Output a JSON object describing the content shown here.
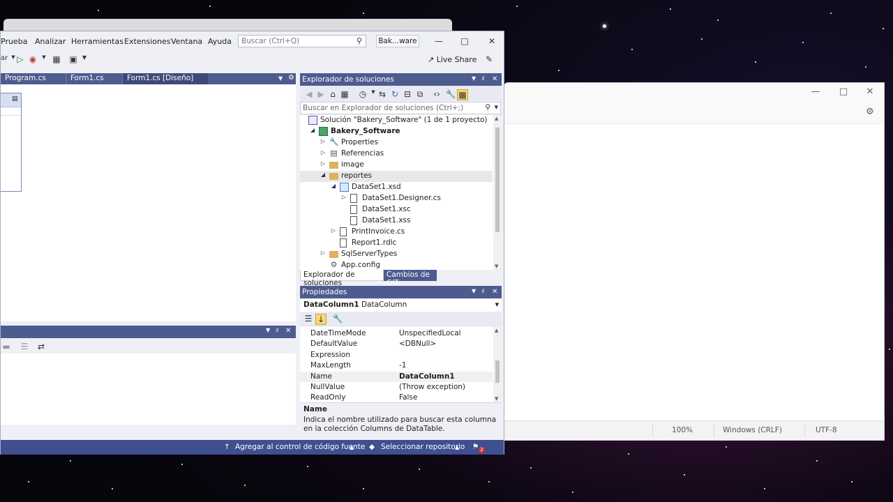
{
  "notepad": {
    "zoom": "100%",
    "line_ending": "Windows (CRLF)",
    "encoding": "UTF-8"
  },
  "vs": {
    "menu": [
      "Prueba",
      "Analizar",
      "Herramientas",
      "Extensiones",
      "Ventana",
      "Ayuda"
    ],
    "search_placeholder": "Buscar (Ctrl+Q)",
    "solution_button": "Bak...ware",
    "live_share": "Live Share",
    "doc_tabs": [
      "Program.cs",
      "Form1.cs",
      "Form1.cs [Diseño]"
    ],
    "statusbar": {
      "source_control": "Agregar al control de código fuente",
      "repository": "Seleccionar repositorio",
      "notifications": "2"
    }
  },
  "solution_explorer": {
    "title": "Explorador de soluciones",
    "search_placeholder": "Buscar en Explorador de soluciones (Ctrl+;)",
    "tree": [
      {
        "label": "Solución \"Bakery_Software\"  (1 de 1 proyecto)",
        "depth": 0,
        "icon": "solution-icon",
        "arrow": ""
      },
      {
        "label": "Bakery_Software",
        "depth": 1,
        "icon": "csharp-project-icon",
        "arrow": "expanded",
        "bold": true
      },
      {
        "label": "Properties",
        "depth": 2,
        "icon": "wrench-icon",
        "arrow": "collapsed"
      },
      {
        "label": "Referencias",
        "depth": 2,
        "icon": "references-icon",
        "arrow": "collapsed"
      },
      {
        "label": "image",
        "depth": 2,
        "icon": "folder-icon",
        "arrow": "collapsed"
      },
      {
        "label": "reportes",
        "depth": 2,
        "icon": "folder-icon",
        "arrow": "expanded",
        "selected": true
      },
      {
        "label": "DataSet1.xsd",
        "depth": 3,
        "icon": "dataset-icon",
        "arrow": "expanded"
      },
      {
        "label": "DataSet1.Designer.cs",
        "depth": 4,
        "icon": "file-icon",
        "arrow": "collapsed"
      },
      {
        "label": "DataSet1.xsc",
        "depth": 4,
        "icon": "file-icon",
        "arrow": ""
      },
      {
        "label": "DataSet1.xss",
        "depth": 4,
        "icon": "file-icon",
        "arrow": ""
      },
      {
        "label": "PrintInvoice.cs",
        "depth": 3,
        "icon": "csharp-file-icon",
        "arrow": "collapsed"
      },
      {
        "label": "Report1.rdlc",
        "depth": 3,
        "icon": "report-icon",
        "arrow": ""
      },
      {
        "label": "SqlServerTypes",
        "depth": 2,
        "icon": "folder-icon",
        "arrow": "collapsed"
      },
      {
        "label": "App.config",
        "depth": 2,
        "icon": "config-icon",
        "arrow": ""
      }
    ],
    "tabs": [
      "Explorador de soluciones",
      "Cambios de GIT"
    ]
  },
  "properties": {
    "title": "Propiedades",
    "object_name": "DataColumn1",
    "object_type": "DataColumn",
    "rows": [
      {
        "name": "DateTimeMode",
        "value": "UnspecifiedLocal"
      },
      {
        "name": "DefaultValue",
        "value": "<DBNull>"
      },
      {
        "name": "Expression",
        "value": ""
      },
      {
        "name": "MaxLength",
        "value": "-1"
      },
      {
        "name": "Name",
        "value": "DataColumn1",
        "selected": true
      },
      {
        "name": "NullValue",
        "value": "(Throw exception)"
      },
      {
        "name": "ReadOnly",
        "value": "False"
      }
    ],
    "description_title": "Name",
    "description_text": "Indica el nombre utilizado para buscar esta columna en la colección Columns de DataTable."
  }
}
